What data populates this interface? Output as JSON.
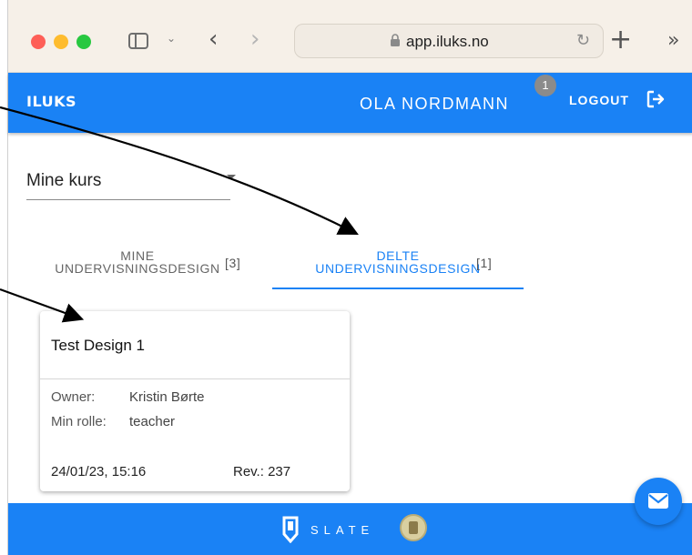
{
  "browser": {
    "url": "app.iluks.no"
  },
  "header": {
    "logo": "ILUKS",
    "user_name": "OLA NORDMANN",
    "notification_count": "1",
    "logout_label": "LOGOUT"
  },
  "course_select": {
    "value": "Mine kurs"
  },
  "tabs": [
    {
      "label": "MINE UNDERVISNINGSDESIGN",
      "line1": "MINE",
      "line2": "UNDERVISNINGSDESIGN",
      "count": "[3]",
      "active": false
    },
    {
      "label": "DELTE UNDERVISNINGSDESIGN",
      "line1": "DELTE",
      "line2": "UNDERVISNINGSDESIGN",
      "count": "[1]",
      "active": true
    }
  ],
  "design_card": {
    "title": "Test Design 1",
    "owner_label": "Owner:",
    "owner_value": "Kristin Børte",
    "role_label": "Min rolle:",
    "role_value": "teacher",
    "date": "24/01/23, 15:16",
    "revision": "Rev.: 237"
  },
  "footer": {
    "brand": "SLATE"
  },
  "colors": {
    "primary": "#1a82f5",
    "badge": "#8b8b8b"
  },
  "icons": {
    "lock": "lock-icon",
    "reload": "reload-icon",
    "logout": "logout-icon",
    "mail": "mail-icon",
    "slate": "slate-logo-icon",
    "seal": "university-seal-icon"
  }
}
